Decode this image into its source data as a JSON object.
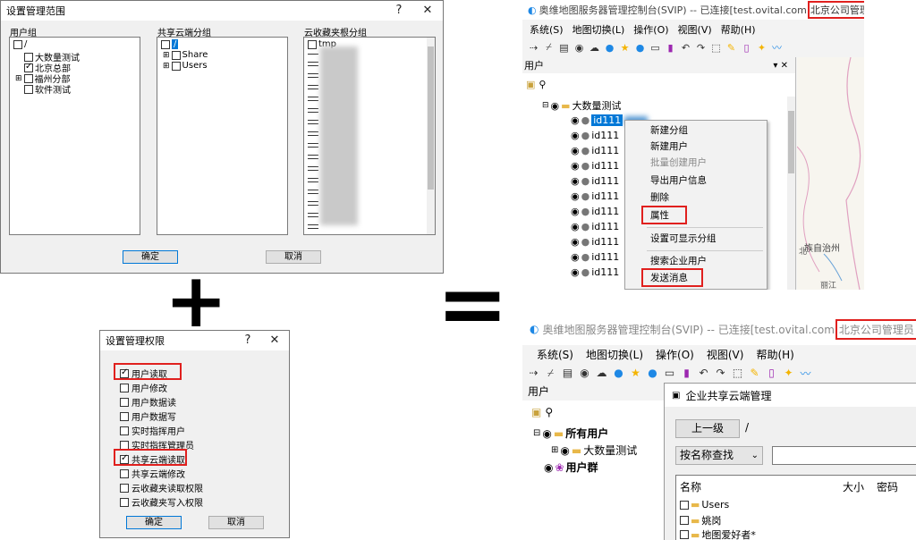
{
  "dlg1": {
    "title": "设置管理范围",
    "help": "?",
    "close": "✕",
    "groups": {
      "user": "用户组",
      "share": "共享云端分组",
      "fav": "云收藏夹根分组"
    },
    "user_tree": {
      "root": "/",
      "items": [
        "大数量测试",
        "北京总部",
        "福州分部",
        "软件测试"
      ]
    },
    "share_tree": {
      "root": "/",
      "items": [
        "Share",
        "Users"
      ]
    },
    "fav_tree": {
      "first": "tmp"
    },
    "ok": "确定",
    "cancel": "取消"
  },
  "plus_sign": "+",
  "equals_sign": "=",
  "dlg2": {
    "title": "设置管理权限",
    "help": "?",
    "close": "✕",
    "perms": [
      {
        "label": "用户读取",
        "checked": true
      },
      {
        "label": "用户修改",
        "checked": false
      },
      {
        "label": "用户数据读",
        "checked": false
      },
      {
        "label": "用户数据写",
        "checked": false
      },
      {
        "label": "实时指挥用户",
        "checked": false
      },
      {
        "label": "实时指挥管理员",
        "checked": false
      },
      {
        "label": "共享云端读取",
        "checked": true
      },
      {
        "label": "共享云端修改",
        "checked": false
      },
      {
        "label": "云收藏夹读取权限",
        "checked": false
      },
      {
        "label": "云收藏夹写入权限",
        "checked": false
      }
    ],
    "ok": "确定",
    "cancel": "取消"
  },
  "app1": {
    "title": "奥维地图服务器管理控制台(SVIP) -- 已连接[test.ovital.com",
    "admin": "北京公司管理员",
    "menus": [
      "系统(S)",
      "地图切换(L)",
      "操作(O)",
      "视图(V)",
      "帮助(H)"
    ],
    "panel_title": "用户",
    "panel_controls": "▾ ✕",
    "group_node": "大数量测试",
    "user_ids": [
      "id111",
      "id111",
      "id111",
      "id111",
      "id111",
      "id111",
      "id111",
      "id111",
      "id111",
      "id111",
      "id111"
    ],
    "context_menu": [
      "新建分组",
      "新建用户",
      "批量创建用户",
      "导出用户信息",
      "删除",
      "属性",
      "设置可显示分组",
      "搜索企业用户",
      "发送消息"
    ],
    "map_labels": [
      "北",
      "族自治州",
      "丽江"
    ]
  },
  "app2": {
    "title": "奥维地图服务器管理控制台(SVIP) -- 已连接[test.ovital.com",
    "admin": "北京公司管理员",
    "menus": [
      "系统(S)",
      "地图切换(L)",
      "操作(O)",
      "视图(V)",
      "帮助(H)"
    ],
    "panel_title": "用户",
    "tree": {
      "all_users": "所有用户",
      "group": "大数量测试",
      "user_group": "用户群"
    },
    "share_dialog": {
      "title": "企业共享云端管理",
      "up_button": "上一级",
      "path": "/",
      "search_mode": "按名称查找",
      "columns": [
        "名称",
        "大小",
        "密码"
      ],
      "files": [
        "Users",
        "姚岗",
        "地图爱好者*"
      ]
    }
  }
}
